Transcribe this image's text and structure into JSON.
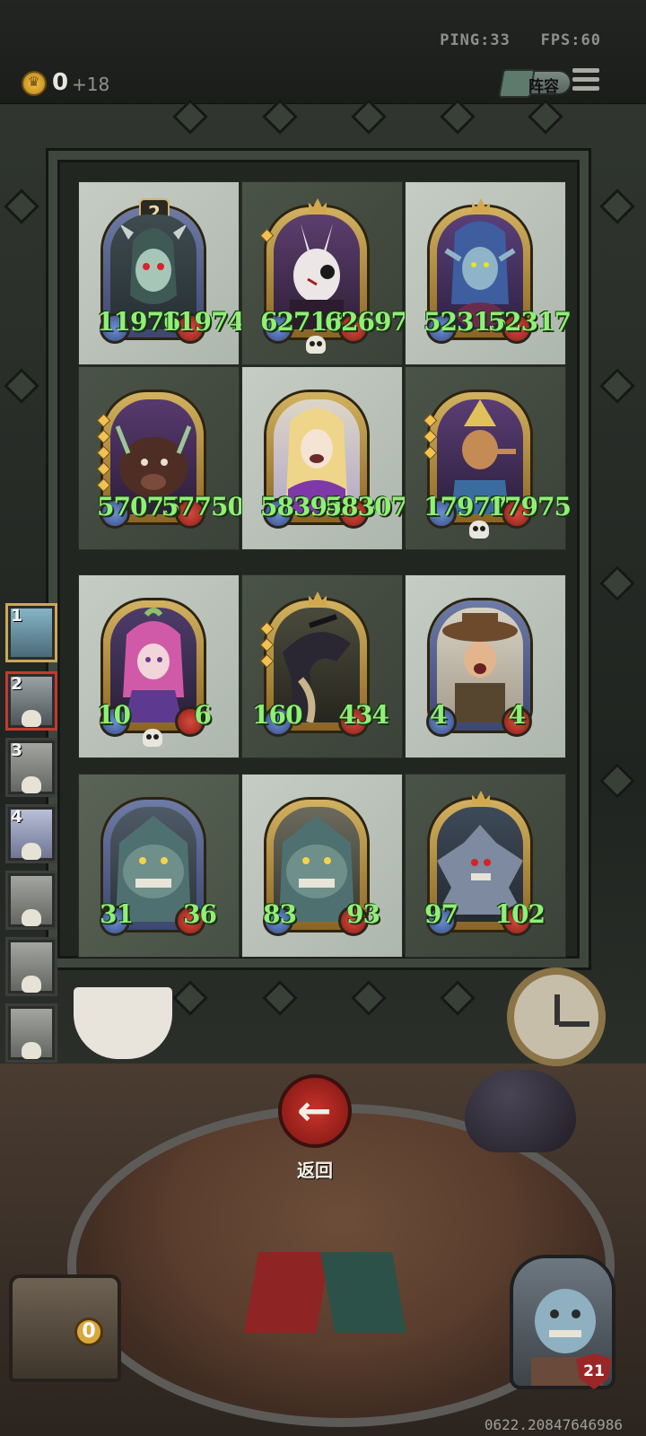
{
  "status": {
    "ping_label": "PING:33",
    "fps_label": "FPS:60"
  },
  "resources": {
    "gold": "0",
    "gold_income": "+18",
    "icon": "crown-coin-icon"
  },
  "header": {
    "lineup_label": "阵容",
    "menu_icon": "hamburger-menu-icon"
  },
  "board": {
    "rows": [
      [
        {
          "name": "demon-girl",
          "level": "2",
          "attack": "11976",
          "health": "11974",
          "skull": false
        },
        {
          "name": "rabbit-mask",
          "attack": "62718",
          "health": "62697",
          "skull": true
        },
        {
          "name": "blue-elf",
          "attack": "52315",
          "health": "52317",
          "skull": false
        }
      ],
      [
        {
          "name": "boar",
          "attack": "57075",
          "health": "57750",
          "skull": false
        },
        {
          "name": "blonde-witch",
          "attack": "58394",
          "health": "58307",
          "skull": false
        },
        {
          "name": "pinocchio",
          "attack": "17977",
          "health": "17975",
          "skull": true
        }
      ],
      [
        {
          "name": "pink-fairy",
          "attack": "10",
          "health": "6",
          "skull": true
        },
        {
          "name": "black-dragon",
          "attack": "160",
          "health": "434",
          "skull": false
        },
        {
          "name": "cowboy",
          "attack": "4",
          "health": "4",
          "skull": false
        }
      ],
      [
        {
          "name": "ogre-a",
          "attack": "31",
          "health": "36",
          "skull": false
        },
        {
          "name": "ogre-b",
          "attack": "83",
          "health": "93",
          "skull": false
        },
        {
          "name": "spider-beast",
          "attack": "97",
          "health": "102",
          "skull": false
        }
      ]
    ]
  },
  "queue": [
    {
      "rank": "1"
    },
    {
      "rank": "2"
    },
    {
      "rank": "3"
    },
    {
      "rank": "4"
    },
    {
      "rank": ""
    },
    {
      "rank": ""
    },
    {
      "rank": ""
    },
    {
      "rank": ""
    }
  ],
  "actions": {
    "back_label": "返回"
  },
  "treasure": {
    "count": "0"
  },
  "player": {
    "health": "21"
  },
  "session_id": "0622.20847646986",
  "colors": {
    "stat_text": "#8ff075",
    "back_button": "#b3261f",
    "gold": "#f5c542"
  }
}
